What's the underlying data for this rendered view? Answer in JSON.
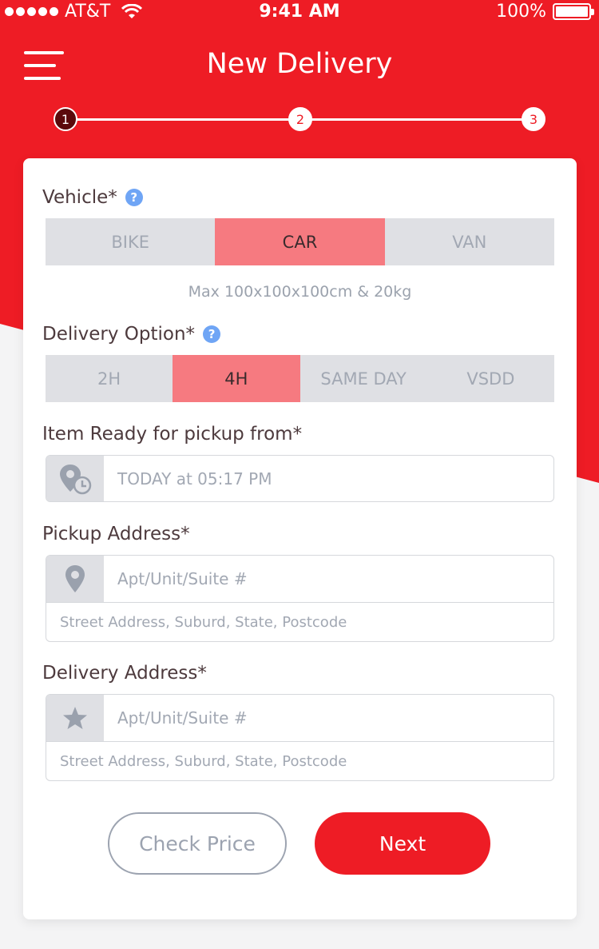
{
  "status_bar": {
    "carrier": "AT&T",
    "time": "9:41 AM",
    "battery": "100%"
  },
  "header": {
    "title": "New Delivery",
    "steps": [
      "1",
      "2",
      "3"
    ],
    "active_step": 1
  },
  "vehicle": {
    "label": "Vehicle*",
    "options": [
      "BIKE",
      "CAR",
      "VAN"
    ],
    "selected": "CAR",
    "note": "Max 100x100x100cm & 20kg"
  },
  "delivery_option": {
    "label": "Delivery Option*",
    "options": [
      "2H",
      "4H",
      "SAME DAY",
      "VSDD"
    ],
    "selected": "4H"
  },
  "pickup_time": {
    "label": "Item Ready for pickup from*",
    "value": "TODAY at 05:17 PM"
  },
  "pickup_address": {
    "label": "Pickup Address*",
    "unit_placeholder": "Apt/Unit/Suite #",
    "street_placeholder": "Street Address, Suburd, State, Postcode"
  },
  "delivery_address": {
    "label": "Delivery Address*",
    "unit_placeholder": "Apt/Unit/Suite #",
    "street_placeholder": "Street Address, Suburd, State, Postcode"
  },
  "actions": {
    "check_price": "Check Price",
    "next": "Next"
  },
  "colors": {
    "brand_red": "#ee1c25",
    "selected_segment": "#f67a80",
    "help_blue": "#6fa5f5"
  }
}
